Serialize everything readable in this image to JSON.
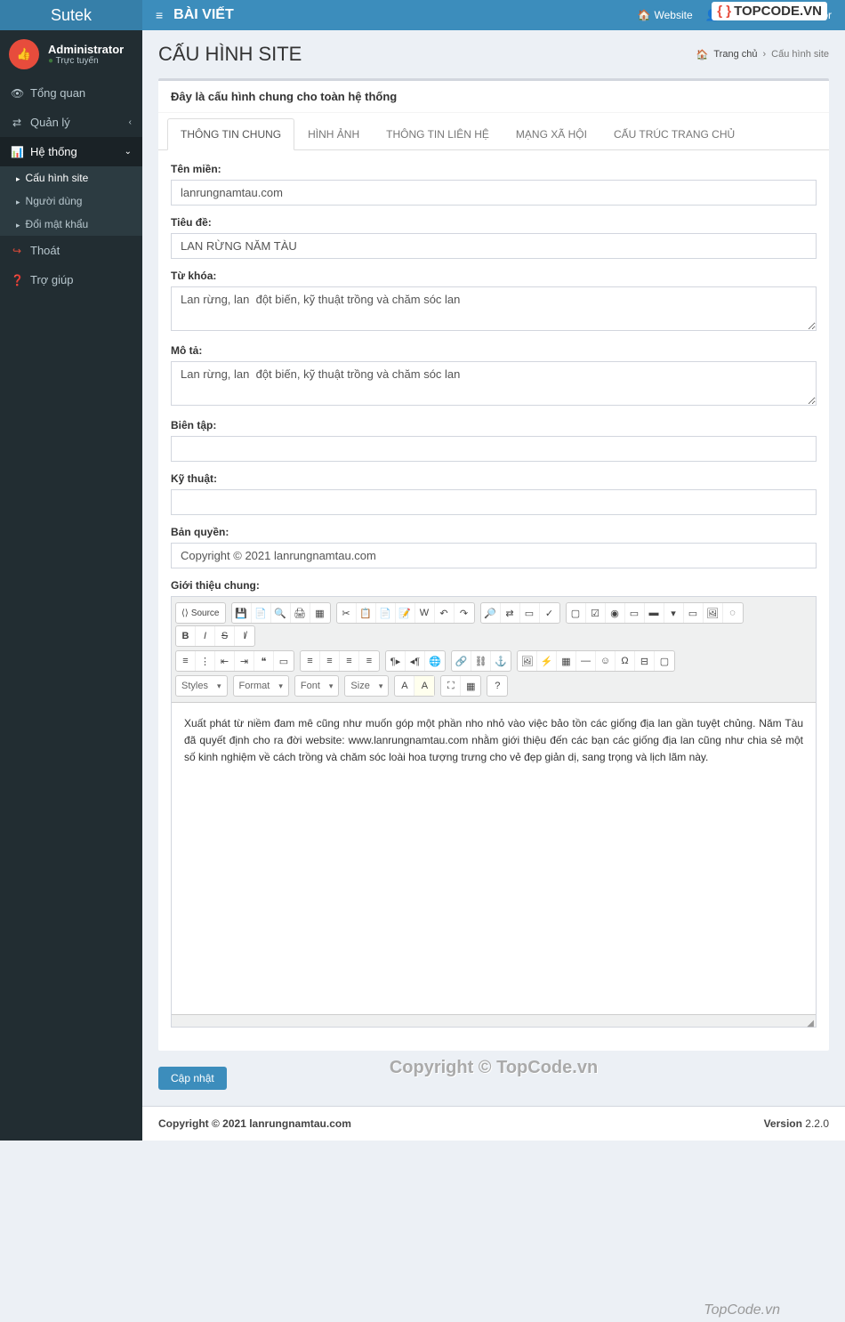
{
  "logo": "Sutek",
  "header": {
    "page_title": "BÀI VIẾT",
    "website_link": "Website",
    "greeting": "Xin chào, Administrator"
  },
  "user": {
    "name": "Administrator",
    "status": "Trực tuyến"
  },
  "sidebar": {
    "overview": "Tổng quan",
    "manage": "Quản lý",
    "system": "Hệ thống",
    "site_config": "Cấu hình site",
    "users": "Người dùng",
    "change_password": "Đổi mật khẩu",
    "logout": "Thoát",
    "help": "Trợ giúp"
  },
  "content": {
    "title": "CẤU HÌNH SITE",
    "breadcrumb_home": "Trang chủ",
    "breadcrumb_current": "Cấu hình site",
    "box_header": "Đây là cấu hình chung cho toàn hệ thống"
  },
  "tabs": {
    "general": "THÔNG TIN CHUNG",
    "image": "HÌNH ẢNH",
    "contact": "THÔNG TIN LIÊN HỆ",
    "social": "MẠNG XÃ HỘI",
    "structure": "CẤU TRÚC TRANG CHỦ"
  },
  "form": {
    "domain_label": "Tên miền:",
    "domain_value": "lanrungnamtau.com",
    "title_label": "Tiêu đề:",
    "title_value": "LAN RỪNG NĂM TÀU",
    "keyword_label": "Từ khóa:",
    "keyword_value": "Lan rừng, lan  đột biến, kỹ thuật trồng và chăm sóc lan",
    "desc_label": "Mô tả:",
    "desc_value": "Lan rừng, lan  đột biến, kỹ thuật trồng và chăm sóc lan",
    "editor_label": "Biên tập:",
    "editor_value": "",
    "tech_label": "Kỹ thuật:",
    "tech_value": "",
    "copyright_label": "Bản quyền:",
    "copyright_value": "Copyright © 2021 lanrungnamtau.com",
    "intro_label": "Giới thiệu chung:",
    "intro_value": "Xuất phát từ niềm đam mê cũng như muốn góp một phần nho nhỏ vào việc bảo tồn các giống địa lan gần tuyệt chủng. Năm Tàu đã quyết định cho ra đời website: www.lanrungnamtau.com nhằm giới thiệu đến các bạn các giống địa lan cũng như chia sẻ một số kinh nghiệm về cách trồng và chăm sóc loài hoa tượng trưng cho vẻ đẹp giản dị, sang trọng và lịch lãm này.",
    "submit": "Cập nhật"
  },
  "editor_toolbar": {
    "source": "Source",
    "styles": "Styles",
    "format": "Format",
    "font": "Font",
    "size": "Size"
  },
  "footer": {
    "copyright": "Copyright © 2021 lanrungnamtau.com",
    "version_label": "Version",
    "version": "2.2.0"
  },
  "watermark": {
    "logo": "TOPCODE.VN",
    "text": "TopCode.vn",
    "center": "Copyright © TopCode.vn"
  }
}
